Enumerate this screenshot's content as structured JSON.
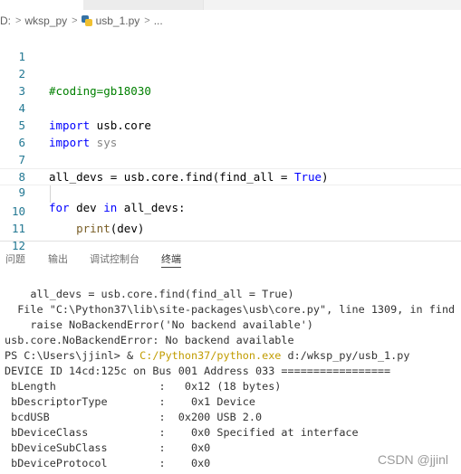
{
  "breadcrumb": {
    "drive": "D:",
    "folder": "wksp_py",
    "file": "usb_1.py",
    "more": "..."
  },
  "editor": {
    "line_numbers": [
      "1",
      "2",
      "3",
      "4",
      "5",
      "6",
      "7",
      "8",
      "9",
      "10",
      "11",
      "12"
    ],
    "coding": "#coding=gb18030",
    "import_kw": "import",
    "usb_core": " usb.core",
    "sys_mod": " sys",
    "assign_a": "all_devs = usb.core.",
    "find_fn": "find",
    "assign_b": "(find_all = ",
    "true_kw": "True",
    "close_paren": ")",
    "for_kw": "for",
    "dev_var": " dev ",
    "in_kw": "in",
    "for_rest": " all_devs:",
    "print_indent": "    ",
    "print_fn": "print",
    "print_arg": "(dev)"
  },
  "panel": {
    "tabs": [
      "问题",
      "输出",
      "调试控制台",
      "终端"
    ],
    "active_tab": "终端",
    "terminal": {
      "l1": "    all_devs = usb.core.find(find_all = True)",
      "l2": "  File \"C:\\Python37\\lib\\site-packages\\usb\\core.py\", line 1309, in find",
      "l3": "    raise NoBackendError('No backend available')",
      "l4": "usb.core.NoBackendError: No backend available",
      "prompt": "PS C:\\Users\\jjinl> & ",
      "exe": "C:/Python37/python.exe",
      "arg": " d:/wksp_py/usb_1.py",
      "l6": "DEVICE ID 14cd:125c on Bus 001 Address 033 =================",
      "l7": " bLength                :   0x12 (18 bytes)",
      "l8": " bDescriptorType        :    0x1 Device",
      "l9": " bcdUSB                 :  0x200 USB 2.0",
      "l10": " bDeviceClass           :    0x0 Specified at interface",
      "l11": " bDeviceSubClass        :    0x0",
      "l12": " bDeviceProtocol        :    0x0"
    }
  },
  "watermark": "CSDN @jjinl"
}
